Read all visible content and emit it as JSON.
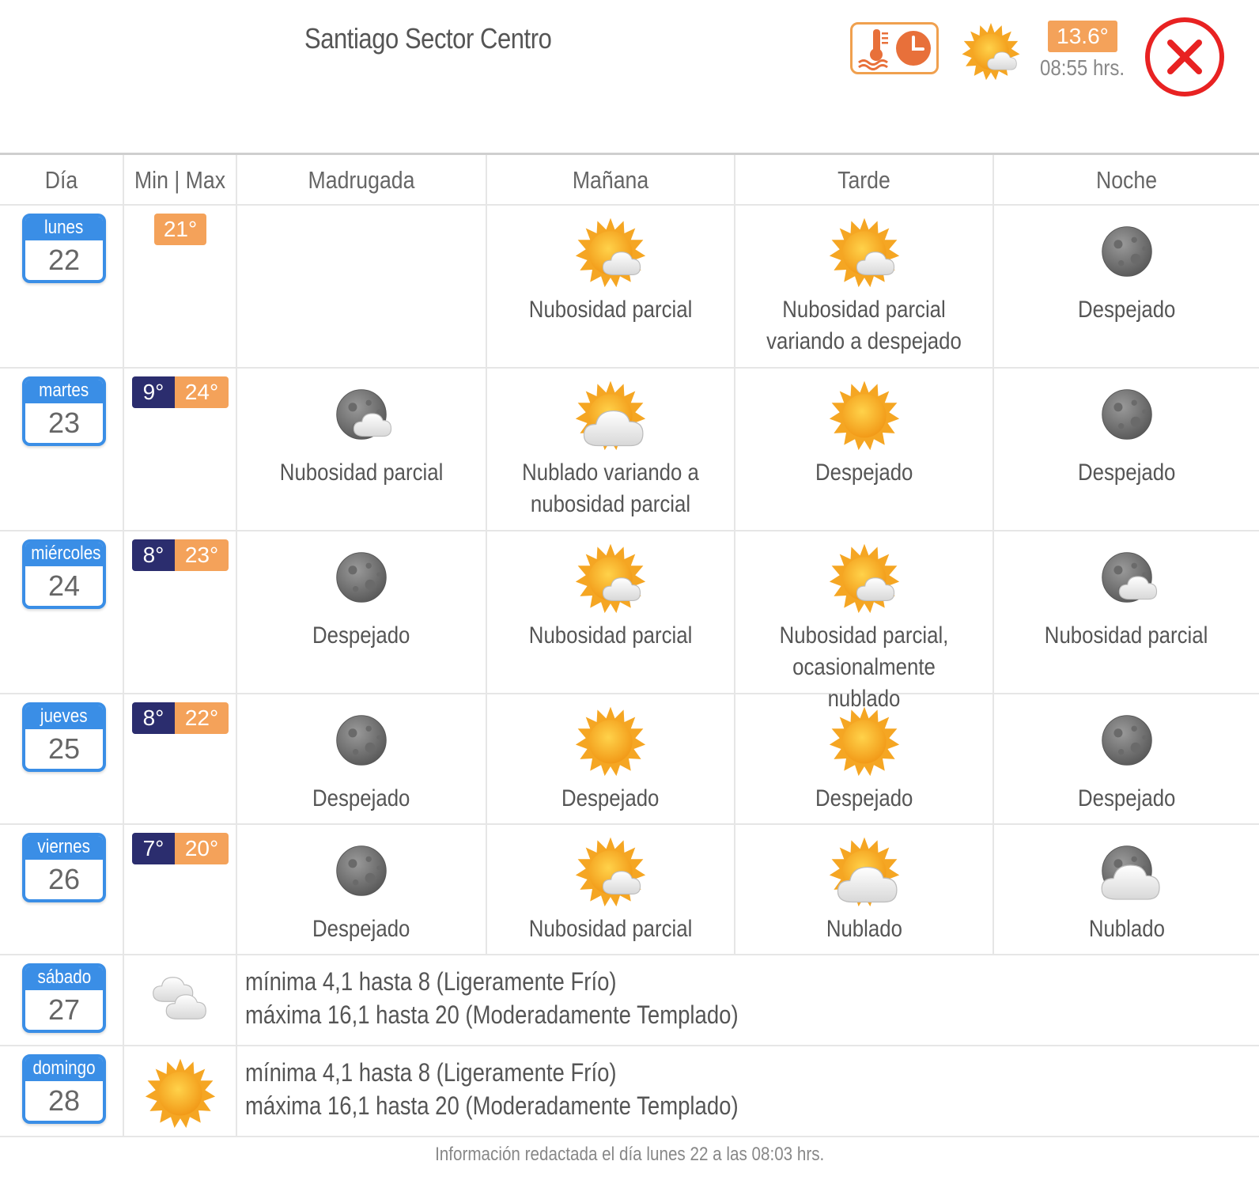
{
  "location": "Santiago Sector Centro",
  "current": {
    "temp": "13.6°",
    "time": "08:55 hrs.",
    "icon": "sun-partly-cloudy-icon"
  },
  "colors": {
    "accent_orange": "#f4a25a",
    "min_navy": "#2b2d6e",
    "day_blue": "#3a8ee6",
    "close_red": "#e82222"
  },
  "headers": {
    "dia": "Día",
    "minmax": "Min | Max",
    "madrugada": "Madrugada",
    "manana": "Mañana",
    "tarde": "Tarde",
    "noche": "Noche"
  },
  "days": [
    {
      "name": "lunes",
      "num": "22",
      "min": "",
      "max": "21°",
      "madrugada": {
        "icon": "",
        "text": ""
      },
      "manana": {
        "icon": "sun-cloud-icon",
        "text": "Nubosidad parcial"
      },
      "tarde": {
        "icon": "sun-cloud-icon",
        "text": "Nubosidad parcial variando a despejado"
      },
      "noche": {
        "icon": "moon-icon",
        "text": "Despejado"
      }
    },
    {
      "name": "martes",
      "num": "23",
      "min": "9°",
      "max": "24°",
      "madrugada": {
        "icon": "moon-cloud-icon",
        "text": "Nubosidad parcial"
      },
      "manana": {
        "icon": "sun-big-cloud-icon",
        "text": "Nublado variando a nubosidad parcial"
      },
      "tarde": {
        "icon": "sun-icon",
        "text": "Despejado"
      },
      "noche": {
        "icon": "moon-icon",
        "text": "Despejado"
      }
    },
    {
      "name": "miércoles",
      "num": "24",
      "min": "8°",
      "max": "23°",
      "madrugada": {
        "icon": "moon-icon",
        "text": "Despejado"
      },
      "manana": {
        "icon": "sun-cloud-icon",
        "text": "Nubosidad parcial"
      },
      "tarde": {
        "icon": "sun-cloud-icon",
        "text": "Nubosidad parcial, ocasionalmente nublado"
      },
      "noche": {
        "icon": "moon-cloud-icon",
        "text": "Nubosidad parcial"
      }
    },
    {
      "name": "jueves",
      "num": "25",
      "min": "8°",
      "max": "22°",
      "madrugada": {
        "icon": "moon-icon",
        "text": "Despejado"
      },
      "manana": {
        "icon": "sun-icon",
        "text": "Despejado"
      },
      "tarde": {
        "icon": "sun-icon",
        "text": "Despejado"
      },
      "noche": {
        "icon": "moon-icon",
        "text": "Despejado"
      }
    },
    {
      "name": "viernes",
      "num": "26",
      "min": "7°",
      "max": "20°",
      "madrugada": {
        "icon": "moon-icon",
        "text": "Despejado"
      },
      "manana": {
        "icon": "sun-cloud-icon",
        "text": "Nubosidad parcial"
      },
      "tarde": {
        "icon": "sun-big-cloud-icon",
        "text": "Nublado"
      },
      "noche": {
        "icon": "moon-big-cloud-icon",
        "text": "Nublado"
      }
    }
  ],
  "extended": [
    {
      "name": "sábado",
      "num": "27",
      "icon": "clouds-icon",
      "line1": "mínima 4,1 hasta 8 (Ligeramente Frío)",
      "line2": "máxima 16,1 hasta 20 (Moderadamente Templado)"
    },
    {
      "name": "domingo",
      "num": "28",
      "icon": "sun-icon",
      "line1": "mínima 4,1 hasta 8 (Ligeramente Frío)",
      "line2": "máxima 16,1 hasta 20 (Moderadamente Templado)"
    }
  ],
  "footer": "Información redactada el día lunes 22 a las 08:03 hrs."
}
